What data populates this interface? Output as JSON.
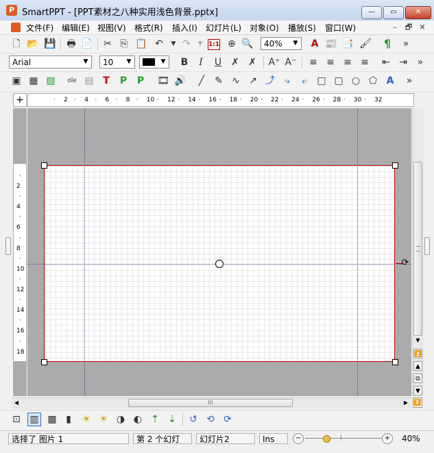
{
  "window": {
    "title": "SmartPPT - [PPT素材之八种实用浅色背景.pptx]",
    "app_icon_letter": "P",
    "minimize": "—",
    "maximize": "▭",
    "close": "✕"
  },
  "menu": {
    "items": [
      "文件(F)",
      "编辑(E)",
      "视图(V)",
      "格式(R)",
      "插入(I)",
      "幻灯片(L)",
      "对象(O)",
      "播放(S)",
      "窗口(W)"
    ],
    "mdi_min": "–",
    "mdi_restore": "🗗",
    "mdi_close": "✕"
  },
  "toolbar1": {
    "zoom_value": "40%",
    "overflow": "»",
    "ratio_label": "1:1"
  },
  "toolbar2": {
    "font_name": "Arial",
    "font_size": "10",
    "bold": "B",
    "italic": "I",
    "underline": "U",
    "overflow": "»"
  },
  "toolbar3": {
    "overflow": "»"
  },
  "ruler": {
    "h_ticks": [
      "2",
      "4",
      "6",
      "8",
      "10",
      "12",
      "14",
      "16",
      "18",
      "20",
      "22",
      "24",
      "26",
      "28",
      "30",
      "32"
    ],
    "v_ticks": [
      "2",
      "4",
      "6",
      "8",
      "10",
      "12",
      "14",
      "16",
      "18"
    ]
  },
  "scroll": {
    "h_grip": "III"
  },
  "status": {
    "selection": "选择了 图片 1",
    "slide_pos": "第 2 个幻灯",
    "slide_name": "幻灯片2",
    "ins": "Ins",
    "zoom": "40%",
    "zoom_fraction": 0.28
  },
  "colors": {
    "accent_red": "#c00000",
    "title_bg": "#c4d6ee",
    "canvas_bg": "#ababab"
  }
}
